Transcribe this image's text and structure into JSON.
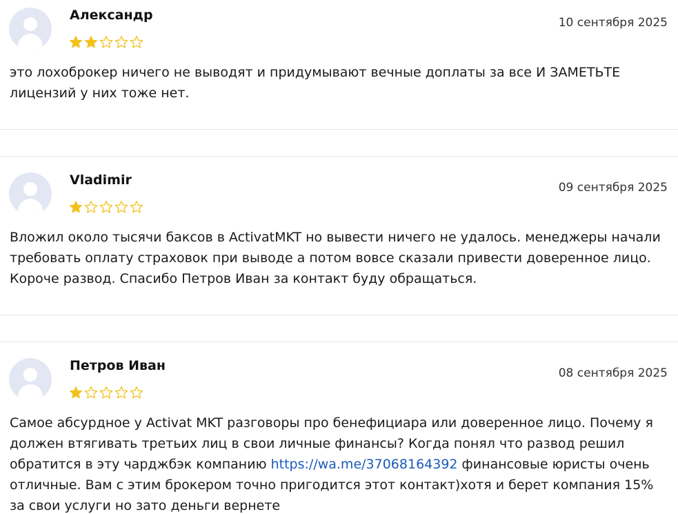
{
  "colors": {
    "star_filled": "#f2c21b",
    "star_empty_stroke": "#f2c21b",
    "avatar_bg": "#e3e7f4",
    "link": "#1a5bb8",
    "divider": "#e6e6e6"
  },
  "reviews": [
    {
      "author": "Александр",
      "date": "10 сентября 2025",
      "rating": 2,
      "text_before_link": "это лохоброкер ничего не выводят и придумывают вечные доплаты за все И ЗАМЕТЬТЕ лицензий у них тоже нет.",
      "link": "",
      "text_after_link": ""
    },
    {
      "author": "Vladimir",
      "date": "09 сентября 2025",
      "rating": 1,
      "text_before_link": "Вложил около тысячи баксов в ActivatMKT но вывести ничего не удалось. менеджеры начали требовать оплату страховок при выводе а потом вовсе сказали привести доверенное лицо. Короче развод. Спасибо Петров Иван за контакт буду обращаться.",
      "link": "",
      "text_after_link": ""
    },
    {
      "author": "Петров Иван",
      "date": "08 сентября 2025",
      "rating": 1,
      "text_before_link": "Самое абсурдное у Activat MKT разговоры про бенефициара или доверенное лицо. Почему я должен втягивать третьих лиц в свои личные финансы? Когда понял что развод решил обратится в эту чарджбэк компанию ",
      "link": "https://wa.me/37068164392",
      "text_after_link": " финансовые юристы очень отличные. Вам с этим брокером точно пригодится этот контакт)хотя и берет компания 15% за свои услуги но зато деньги вернете"
    }
  ]
}
